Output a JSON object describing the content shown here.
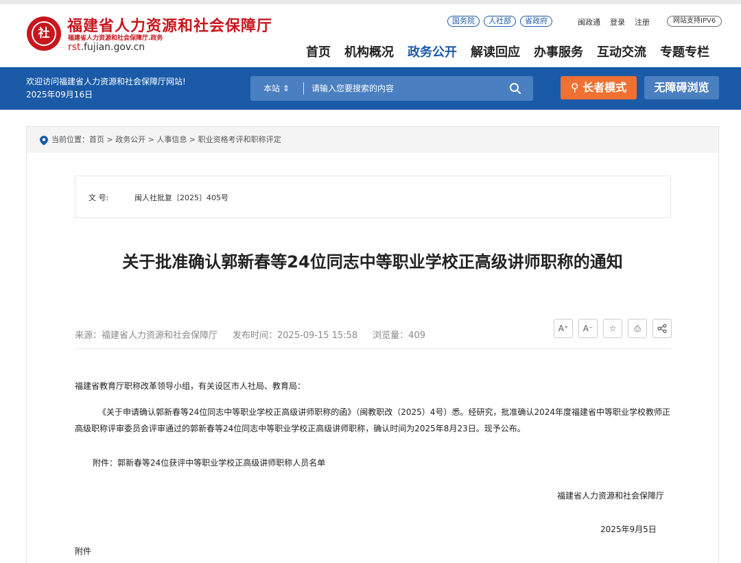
{
  "header": {
    "logo_text": "社",
    "site_name": "福建省人力资源和社会保障厅",
    "site_sub": "福建省人力资源和社会保障厅.政务",
    "domain_prefix": "rst",
    "domain_rest": ".fujian.gov.cn",
    "quick_links": [
      "国务院",
      "人社部",
      "省政府"
    ],
    "top_links": [
      "闽政通",
      "登录",
      "注册"
    ],
    "ipv6": "网站支持IPV6",
    "nav": [
      {
        "label": "首页",
        "active": false
      },
      {
        "label": "机构概况",
        "active": false
      },
      {
        "label": "政务公开",
        "active": true
      },
      {
        "label": "解读回应",
        "active": false
      },
      {
        "label": "办事服务",
        "active": false
      },
      {
        "label": "互动交流",
        "active": false
      },
      {
        "label": "专题专栏",
        "active": false
      }
    ]
  },
  "bluebar": {
    "welcome": "欢迎访问福建省人力资源和社会保障厅网站!",
    "date": "2025年09月16日",
    "search_scope": "本站 ⇕",
    "search_placeholder": "请输入您要搜索的内容",
    "elder_mode": "长者模式",
    "accessible": "无障碍浏览"
  },
  "breadcrumb": "当前位置：首页 > 政务公开 > 人事信息 > 职业资格考评和职称评定",
  "doc": {
    "label": "文 号:",
    "number": "闽人社批复〔2025〕405号"
  },
  "article": {
    "title": "关于批准确认郭新春等24位同志中等职业学校正高级讲师职称的通知",
    "source": "来源：福建省人力资源和社会保障厅",
    "publish_time": "发布时间：2025-09-15 15:58",
    "views": "浏览量：409",
    "p1": "福建省教育厅职称改革领导小组，有关设区市人社局、教育局：",
    "p2": "《关于申请确认郭新春等24位同志中等职业学校正高级讲师职称的函》（闽教职改（2025）4号）悉。经研究，批准确认2024年度福建省中等职业学校教师正高级职称评审委员会评审通过的郭新春等24位同志中等职业学校正高级讲师职称，确认时间为2025年8月23日。现予公布。",
    "p3": "附件：郭新春等24位获评中等职业学校正高级讲师职称人员名单",
    "signature": "福建省人力资源和社会保障厅",
    "sign_date": "2025年9月5日",
    "p4": "附件"
  },
  "tools": [
    "A⁺",
    "A⁻",
    "☆",
    "⎙",
    "share"
  ],
  "colors": {
    "brand_red": "#c8161d",
    "brand_blue": "#1a5aa7",
    "orange": "#f07131"
  }
}
